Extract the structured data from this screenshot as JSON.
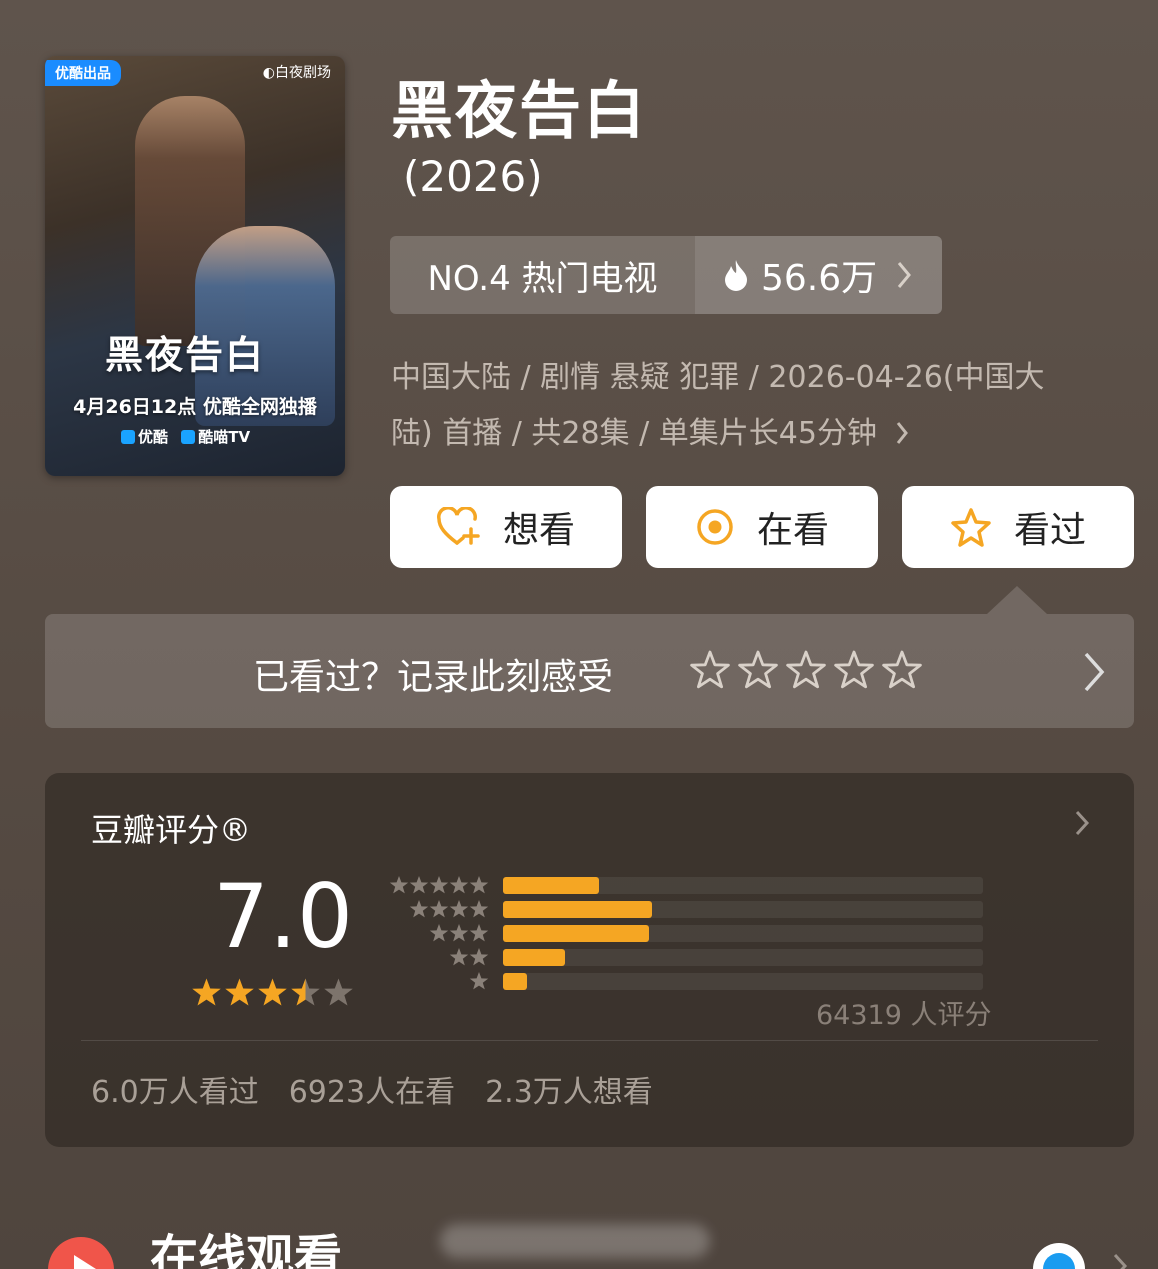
{
  "poster": {
    "badge": "优酷出品",
    "studio": "◐白夜剧场",
    "title": "黑夜告白",
    "premiere": "4月26日12点 优酷全网独播",
    "platforms": [
      "优酷",
      "酷喵TV"
    ]
  },
  "show": {
    "title": "黑夜告白",
    "year": "(2026)"
  },
  "rank": {
    "label": "NO.4 热门电视",
    "heat": "56.6万"
  },
  "meta": {
    "line1": "中国大陆 / 剧情 悬疑 犯罪 / 2026-04-26(中国大",
    "line2": "陆) 首播 / 共28集 / 单集片长45分钟"
  },
  "actions": {
    "want": "想看",
    "watching": "在看",
    "watched": "看过"
  },
  "record": {
    "prompt": "已看过？记录此刻感受",
    "star_count": 5
  },
  "rating": {
    "label": "豆瓣评分®",
    "score": "7.0",
    "stars": 3.5,
    "distribution": [
      {
        "stars": 5,
        "fraction": 0.2
      },
      {
        "stars": 4,
        "fraction": 0.31
      },
      {
        "stars": 3,
        "fraction": 0.305
      },
      {
        "stars": 2,
        "fraction": 0.13
      },
      {
        "stars": 1,
        "fraction": 0.05
      }
    ],
    "count": "64319 人评分",
    "stats": [
      "6.0万人看过",
      "6923人在看",
      "2.3万人想看"
    ]
  },
  "online": {
    "title": "在线观看"
  },
  "colors": {
    "accent": "#f5a623",
    "star_gray": "#7d746c"
  }
}
